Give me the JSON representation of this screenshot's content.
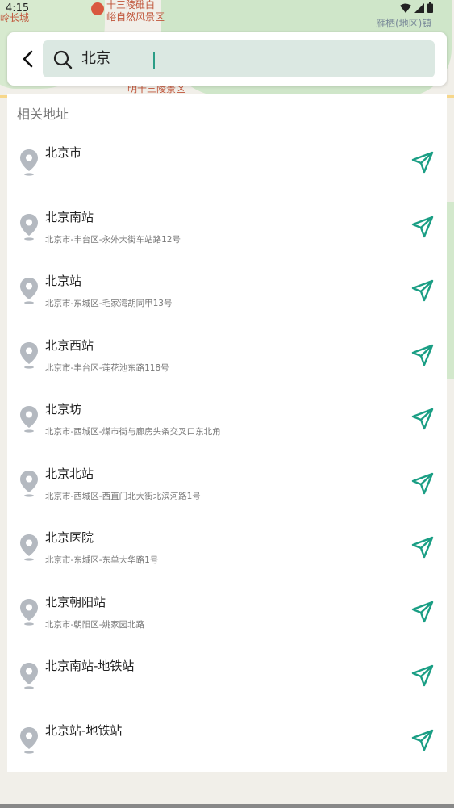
{
  "status_bar": {
    "time": "4:15"
  },
  "map": {
    "labels": [
      "十三陵碓白",
      "峪自然风景区",
      "明十三陵景区",
      "岭长城",
      "雁栖(地区)镇"
    ]
  },
  "search": {
    "query": "北京"
  },
  "results": {
    "header": "相关地址",
    "items": [
      {
        "name": "北京市",
        "address": ""
      },
      {
        "name": "北京南站",
        "address": "北京市-丰台区-永外大街车站路12号"
      },
      {
        "name": "北京站",
        "address": "北京市-东城区-毛家湾胡同甲13号"
      },
      {
        "name": "北京西站",
        "address": "北京市-丰台区-莲花池东路118号"
      },
      {
        "name": "北京坊",
        "address": "北京市-西城区-煤市街与廊房头条交叉口东北角"
      },
      {
        "name": "北京北站",
        "address": "北京市-西城区-西直门北大街北滨河路1号"
      },
      {
        "name": "北京医院",
        "address": "北京市-东城区-东单大华路1号"
      },
      {
        "name": "北京朝阳站",
        "address": "北京市-朝阳区-姚家园北路"
      },
      {
        "name": "北京南站-地铁站",
        "address": ""
      },
      {
        "name": "北京站-地铁站",
        "address": ""
      }
    ]
  },
  "colors": {
    "accent": "#1a9e84",
    "pin": "#b3b8bf",
    "search_bg": "#dbe8e2"
  }
}
